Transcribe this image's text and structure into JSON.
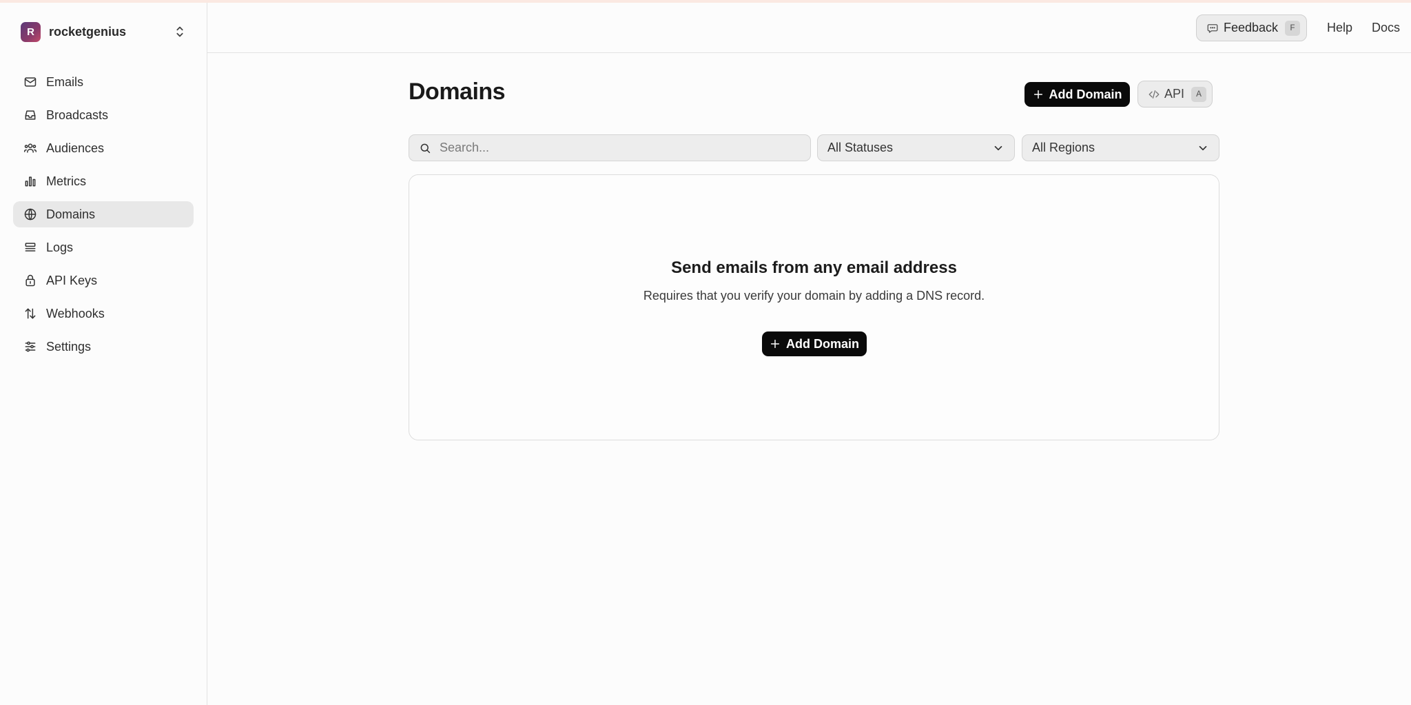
{
  "team": {
    "initial": "R",
    "name": "rocketgenius"
  },
  "sidebar": {
    "items": [
      {
        "label": "Emails",
        "icon": "mail-icon"
      },
      {
        "label": "Broadcasts",
        "icon": "inbox-icon"
      },
      {
        "label": "Audiences",
        "icon": "users-icon"
      },
      {
        "label": "Metrics",
        "icon": "bar-chart-icon"
      },
      {
        "label": "Domains",
        "icon": "globe-icon",
        "active": true
      },
      {
        "label": "Logs",
        "icon": "logs-icon"
      },
      {
        "label": "API Keys",
        "icon": "lock-icon"
      },
      {
        "label": "Webhooks",
        "icon": "arrows-up-down-icon"
      },
      {
        "label": "Settings",
        "icon": "sliders-icon"
      }
    ]
  },
  "header": {
    "feedback_label": "Feedback",
    "feedback_shortcut": "F",
    "help_label": "Help",
    "docs_label": "Docs"
  },
  "main": {
    "title": "Domains",
    "add_domain_label": "Add Domain",
    "api_label": "API",
    "api_shortcut": "A",
    "search_placeholder": "Search...",
    "status_filter": "All Statuses",
    "region_filter": "All Regions"
  },
  "empty_state": {
    "title": "Send emails from any email address",
    "description": "Requires that you verify your domain by adding a DNS record.",
    "button_label": "Add Domain"
  },
  "colors": {
    "primary_button": "#0a0a0a",
    "active_nav_bg": "#e8e8e8",
    "top_accent": "#fbe9e2"
  }
}
